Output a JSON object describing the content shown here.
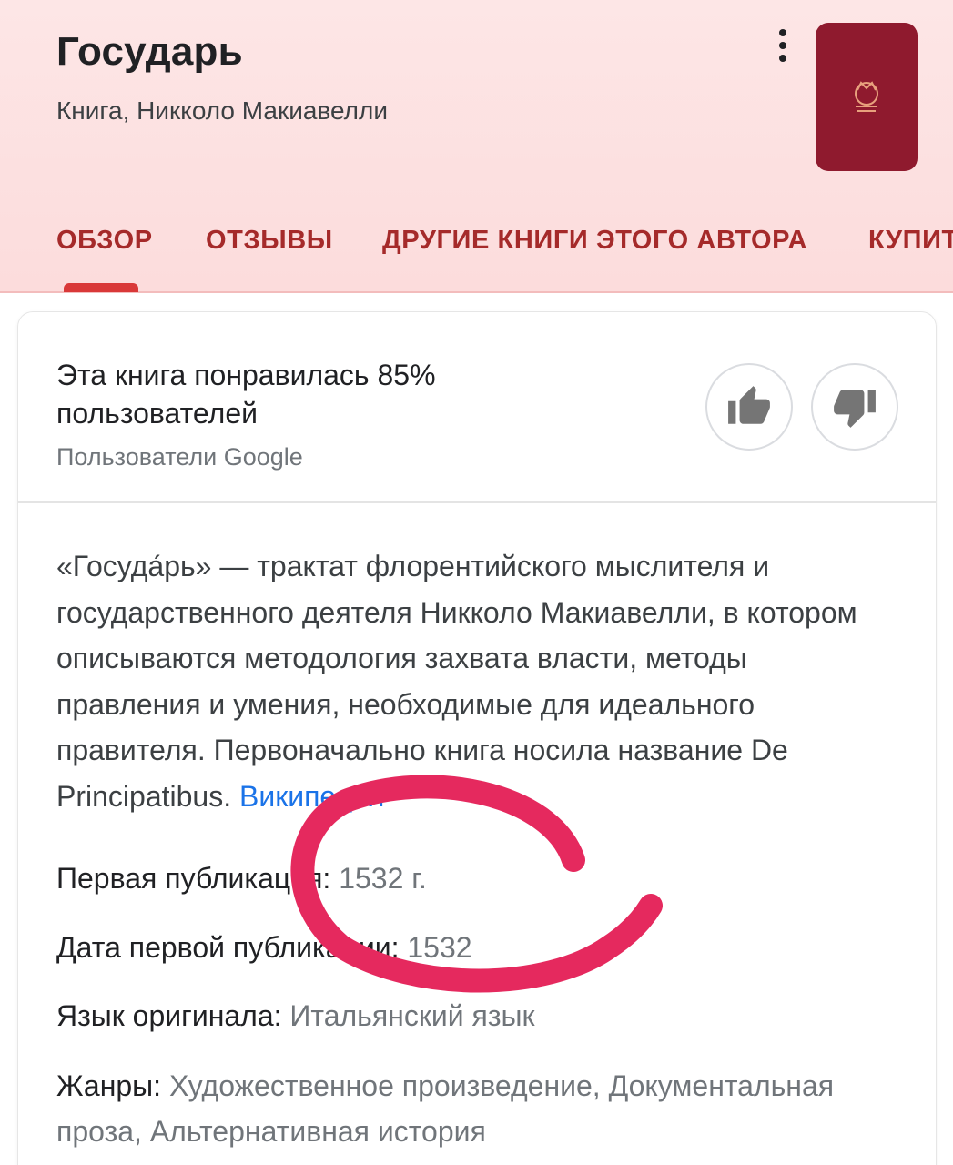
{
  "header": {
    "title": "Государь",
    "subtitle": "Книга, Никколо Макиавелли",
    "more_icon": "more-vert-icon",
    "accent_color": "#a52a2a",
    "cover_color": "#8f1a2e"
  },
  "tabs": [
    {
      "label": "ОБЗОР",
      "active": true
    },
    {
      "label": "ОТЗЫВЫ",
      "active": false
    },
    {
      "label": "ДРУГИЕ КНИГИ ЭТОГО АВТОРА",
      "active": false
    },
    {
      "label": "КУПИТ",
      "active": false
    }
  ],
  "rating": {
    "text": "Эта книга понравилась 85% пользователей",
    "source": "Пользователи Google",
    "like_icon": "thumb-up-icon",
    "dislike_icon": "thumb-down-icon"
  },
  "description": {
    "text": "«Госуда́рь» — трактат флорентийского мыслителя и государственного деятеля Никколо Макиавелли, в котором описываются методология захвата власти, методы правления и умения, необходимые для идеального правителя. Первоначально книга носила название De Principatibus. ",
    "source_link": "Википедия"
  },
  "facts": [
    {
      "label": "Первая публикация: ",
      "value": "1532 г."
    },
    {
      "label": "Дата первой публикации: ",
      "value": "1532"
    },
    {
      "label": "Язык оригинала: ",
      "value": "Итальянский язык"
    },
    {
      "label": "Жанры: ",
      "value": "Художественное произведение, Документальная проза, Альтернативная история"
    }
  ],
  "annotation": {
    "color": "#e5295e"
  }
}
